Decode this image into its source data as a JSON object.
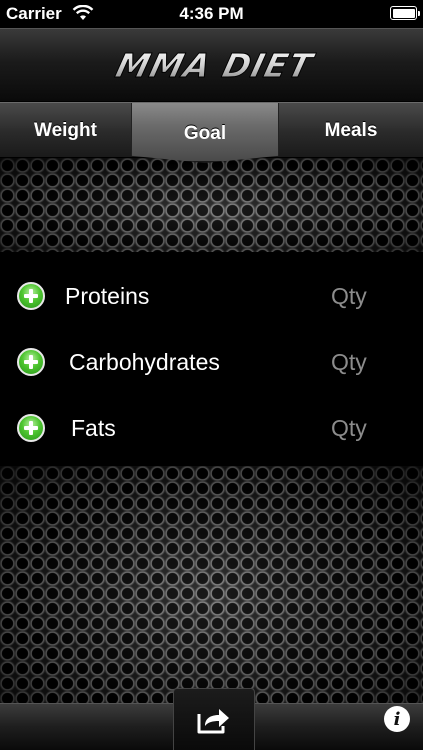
{
  "status_bar": {
    "carrier": "Carrier",
    "time": "4:36 PM"
  },
  "header": {
    "logo_text": "MMA DIET"
  },
  "tabs": [
    {
      "label": "Weight",
      "selected": false
    },
    {
      "label": "Goal",
      "selected": true
    },
    {
      "label": "Meals",
      "selected": false
    }
  ],
  "nutrients": [
    {
      "label": "Proteins",
      "qty": "Qty"
    },
    {
      "label": "Carbohydrates",
      "qty": "Qty"
    },
    {
      "label": "Fats",
      "qty": "Qty"
    }
  ],
  "icons": {
    "add": "add-icon",
    "share": "share-icon",
    "info": "info-icon"
  },
  "colors": {
    "add_green": "#4ec530",
    "qty_gray": "#8c8c8c"
  }
}
